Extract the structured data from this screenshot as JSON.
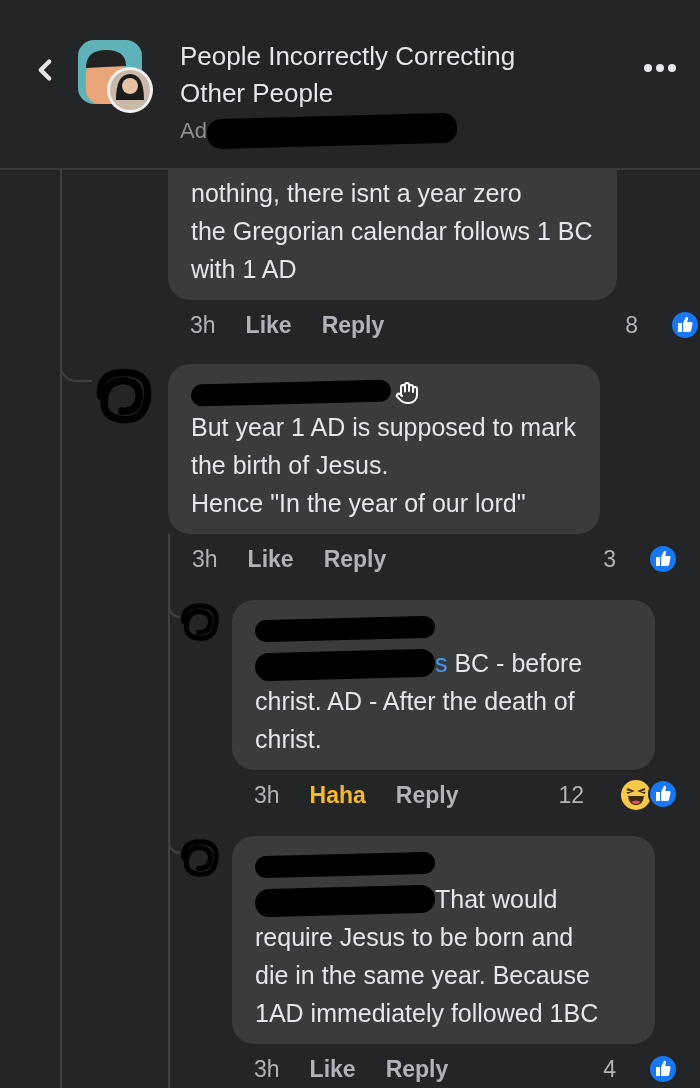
{
  "header": {
    "title": "People Incorrectly Correcting Other People",
    "subtitle": "Ad"
  },
  "comments": [
    {
      "body": "nothing, there isnt a year zero\nthe Gregorian calendar follows 1 BC\nwith 1 AD",
      "time": "3h",
      "reaction_label": "Like",
      "reacted": false,
      "reply": "Reply",
      "count": "8",
      "reactions": [
        {
          "kind": "like"
        }
      ]
    },
    {
      "name_badge": {
        "kind": "wave"
      },
      "body": "But year 1 AD is supposed to mark\nthe birth of Jesus.\nHence \"In the year of our lord\"",
      "time": "3h",
      "reaction_label": "Like",
      "reacted": false,
      "reply": "Reply",
      "count": "3",
      "reactions": [
        {
          "kind": "like"
        }
      ],
      "replies": [
        {
          "mention": "s",
          "body": " BC - before\nchrist. AD - After the death of\nchrist.",
          "time": "3h",
          "reaction_label": "Haha",
          "reacted": true,
          "reply": "Reply",
          "count": "12",
          "reactions": [
            {
              "kind": "haha"
            },
            {
              "kind": "like"
            }
          ]
        },
        {
          "body": "That would\nrequire Jesus to be born and\ndie in the same year. Because\n1AD immediately followed 1BC",
          "time": "3h",
          "reaction_label": "Like",
          "reacted": false,
          "reply": "Reply",
          "count": "4",
          "reactions": [
            {
              "kind": "like"
            }
          ]
        }
      ]
    }
  ]
}
